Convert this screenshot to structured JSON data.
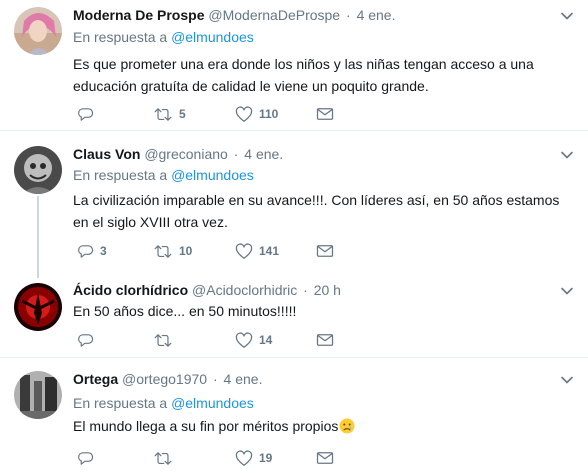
{
  "tweets": [
    {
      "name": "Moderna De Prospe",
      "handle": "@ModernaDeProspe",
      "time": "4 ene.",
      "reply_prefix": "En respuesta a",
      "reply_to": "@elmundoes",
      "text_line1": "Es que prometer una era donde los niños y las niñas tengan acceso a una",
      "text_line2": "educación gratuíta de calidad le viene un poquito grande.",
      "replies": "",
      "retweets": "5",
      "likes": "110"
    },
    {
      "name": "Claus Von",
      "handle": "@greconiano",
      "time": "4 ene.",
      "reply_prefix": "En respuesta a",
      "reply_to": "@elmundoes",
      "text_line1": "La civilización imparable en su avance!!!.  Con líderes así, en 50 años estamos",
      "text_line2": "en el  siglo XVIII otra vez.",
      "replies": "3",
      "retweets": "10",
      "likes": "141"
    },
    {
      "name": "Ácido clorhídrico",
      "handle": "@Acidoclorhidric",
      "time": "20 h",
      "text_line1": "En 50 años dice... en 50 minutos!!!!!",
      "replies": "",
      "retweets": "",
      "likes": "14"
    },
    {
      "name": "Ortega",
      "handle": "@ortego1970",
      "time": "4 ene.",
      "reply_prefix": "En respuesta a",
      "reply_to": "@elmundoes",
      "text_line1": "El mundo llega a su fin por méritos propios",
      "replies": "",
      "retweets": "",
      "likes": "19"
    }
  ],
  "separator_dot": "·",
  "colors": {
    "mention": "#1b95e0",
    "secondary": "#657786",
    "primary": "#14171a",
    "divider": "#e6ecf0",
    "thread_line": "#ccd6dd"
  },
  "icons": [
    "reply-icon",
    "retweet-icon",
    "like-icon",
    "message-icon",
    "caret-down-icon",
    "crying-face-emoji"
  ]
}
